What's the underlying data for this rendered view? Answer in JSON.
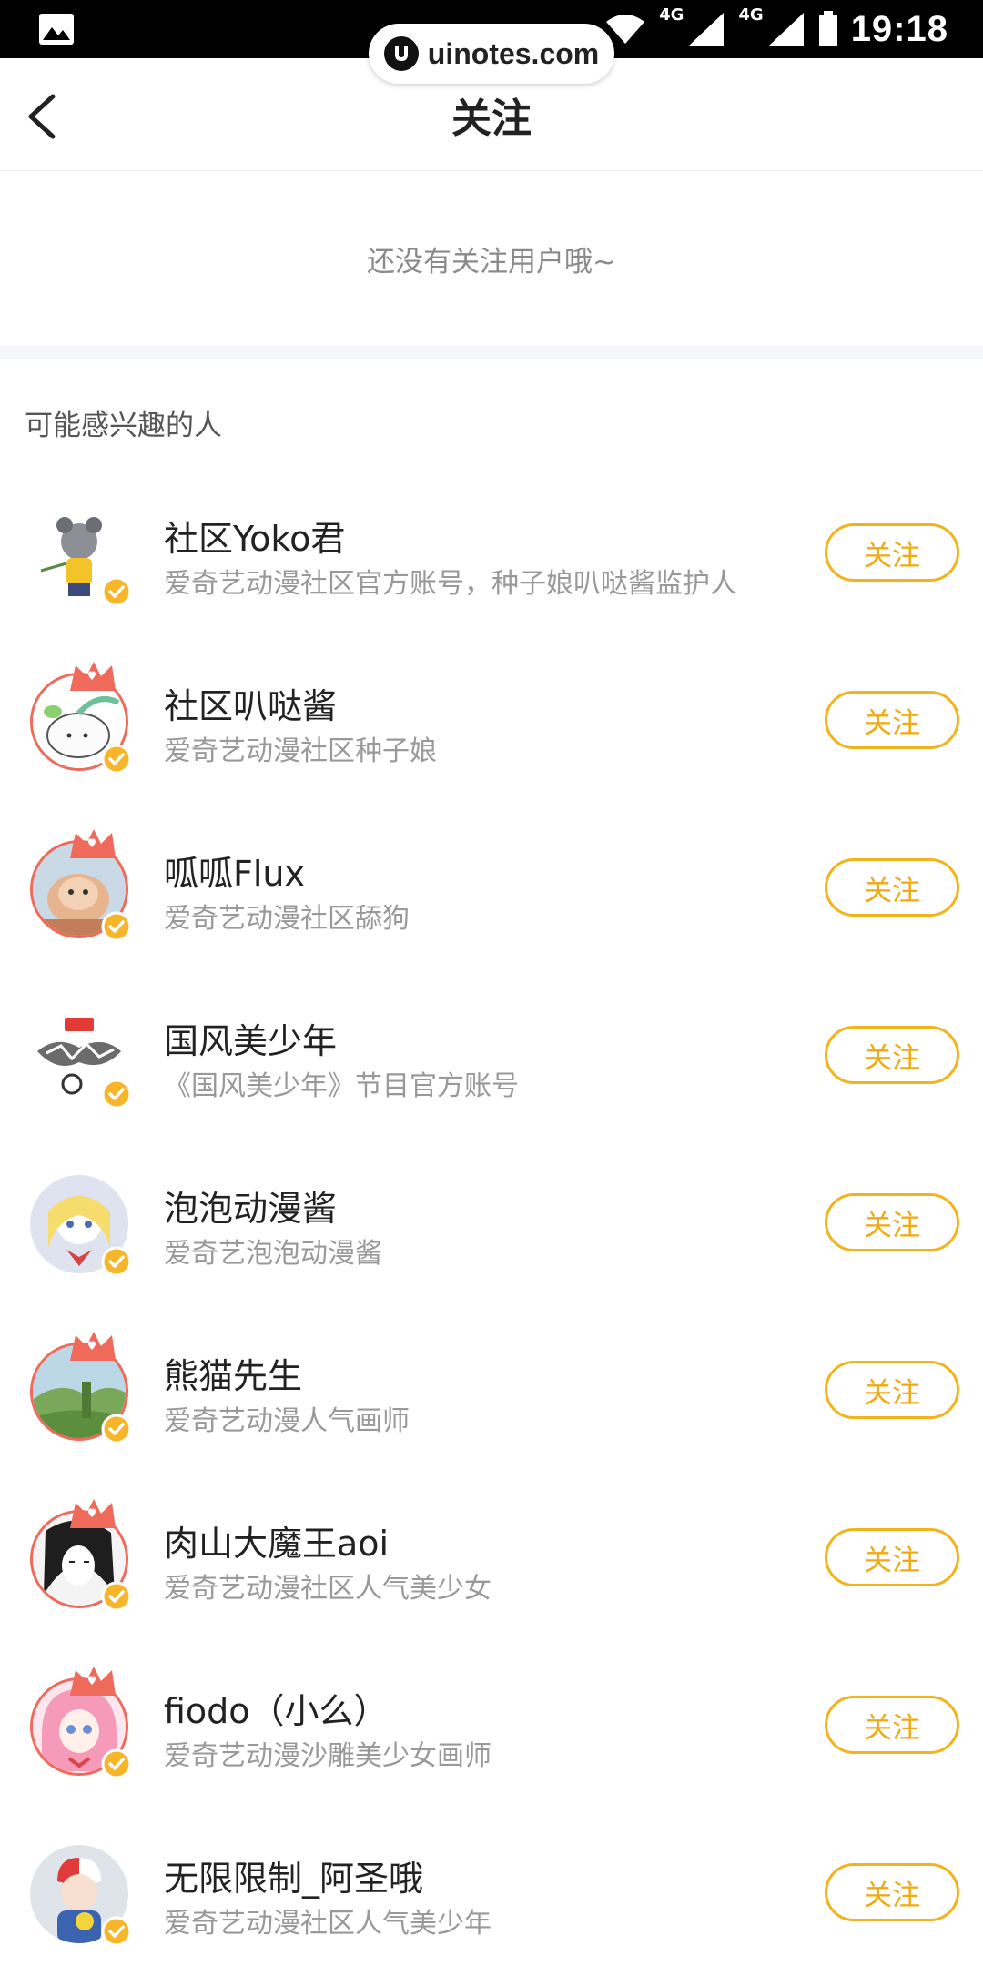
{
  "status_bar": {
    "time": "19:18",
    "network_1": "4G",
    "network_2": "4G"
  },
  "watermark": {
    "text": "uinotes.com"
  },
  "header": {
    "title": "关注"
  },
  "empty_state": {
    "text": "还没有关注用户哦~"
  },
  "section": {
    "title": "可能感兴趣的人"
  },
  "colors": {
    "accent": "#f3b31b",
    "ring": "#ef6a5a",
    "verified": "#f7b52a"
  },
  "users": [
    {
      "name": "社区Yoko君",
      "desc": "爱奇艺动漫社区官方账号，种子娘叭哒酱监护人",
      "follow_label": "关注",
      "avatar": "character-avatar",
      "ring": false
    },
    {
      "name": "社区叭哒酱",
      "desc": "爱奇艺动漫社区种子娘",
      "follow_label": "关注",
      "avatar": "seed-mascot-avatar",
      "ring": true
    },
    {
      "name": "呱呱Flux",
      "desc": "爱奇艺动漫社区舔狗",
      "follow_label": "关注",
      "avatar": "pet-avatar",
      "ring": true
    },
    {
      "name": "国风美少年",
      "desc": "《国风美少年》节目官方账号",
      "follow_label": "关注",
      "avatar": "show-logo-avatar",
      "ring": false
    },
    {
      "name": "泡泡动漫酱",
      "desc": "爱奇艺泡泡动漫酱",
      "follow_label": "关注",
      "avatar": "anime-girl-avatar",
      "ring": false
    },
    {
      "name": "熊猫先生",
      "desc": "爱奇艺动漫人气画师",
      "follow_label": "关注",
      "avatar": "landscape-avatar",
      "ring": true
    },
    {
      "name": "肉山大魔王aoi",
      "desc": "爱奇艺动漫社区人气美少女",
      "follow_label": "关注",
      "avatar": "sketch-girl-avatar",
      "ring": true
    },
    {
      "name": "fiodo（小么）",
      "desc": "爱奇艺动漫沙雕美少女画师",
      "follow_label": "关注",
      "avatar": "pink-hair-avatar",
      "ring": true
    },
    {
      "name": "无限限制_阿圣哦",
      "desc": "爱奇艺动漫社区人气美少年",
      "follow_label": "关注",
      "avatar": "anime-boy-avatar",
      "ring": false
    }
  ]
}
